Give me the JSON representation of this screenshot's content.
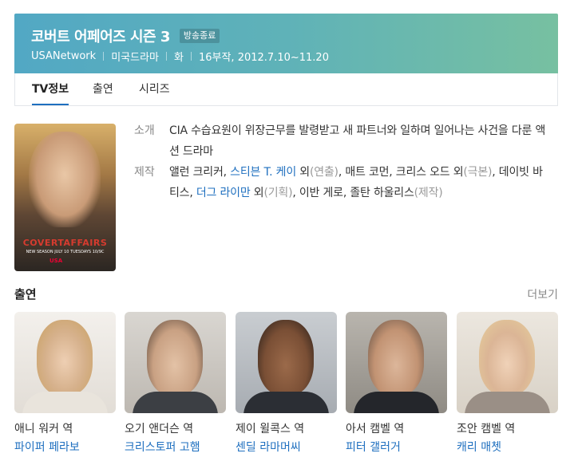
{
  "header": {
    "title": "코버트 어페어즈 시즌 3",
    "badge": "방송종료",
    "meta": [
      "USANetwork",
      "미국드라마",
      "화",
      "16부작, 2012.7.10~11.20"
    ]
  },
  "tabs": [
    "TV정보",
    "출연",
    "시리즈"
  ],
  "poster": {
    "title_text": "COVERTAFFAIRS",
    "sub_text": "NEW SEASON JULY 10 TUESDAYS 10/9C",
    "logo_text": "USA"
  },
  "info": {
    "intro_label": "소개",
    "intro_text": "CIA 수습요원이 위장근무를 발령받고 새 파트너와 일하며 일어나는 사건을 다룬 액션 드라마",
    "credits_label": "제작",
    "credits": {
      "p1": "앨런 크리커, ",
      "link1": "스티븐 T. 케이",
      "p2": " 외",
      "m1": "(연출)",
      "p3": ", 매트 코먼, 크리스 오드 외",
      "m2": "(극본)",
      "p4": ", 데이빗 바티스, ",
      "link2": "더그 라이만",
      "p5": " 외",
      "m3": "(기획)",
      "p6": ", 이반 게로, 졸탄 하울리스",
      "m4": "(제작)"
    }
  },
  "cast_section": {
    "title": "출연",
    "more": "더보기",
    "items": [
      {
        "role": "애니 워커 역",
        "actor": "파이퍼 페라보"
      },
      {
        "role": "오기 앤더슨 역",
        "actor": "크리스토퍼 고햄"
      },
      {
        "role": "제이 윌콕스 역",
        "actor": "센딜 라마머씨"
      },
      {
        "role": "아서 캠벨 역",
        "actor": "피터 갤러거"
      },
      {
        "role": "조안 캠벨 역",
        "actor": "캐리 매쳇"
      }
    ]
  },
  "colors": {
    "header_gradient_start": "#52a8c4",
    "header_gradient_end": "#77c0a1",
    "link": "#1e6fbf"
  }
}
